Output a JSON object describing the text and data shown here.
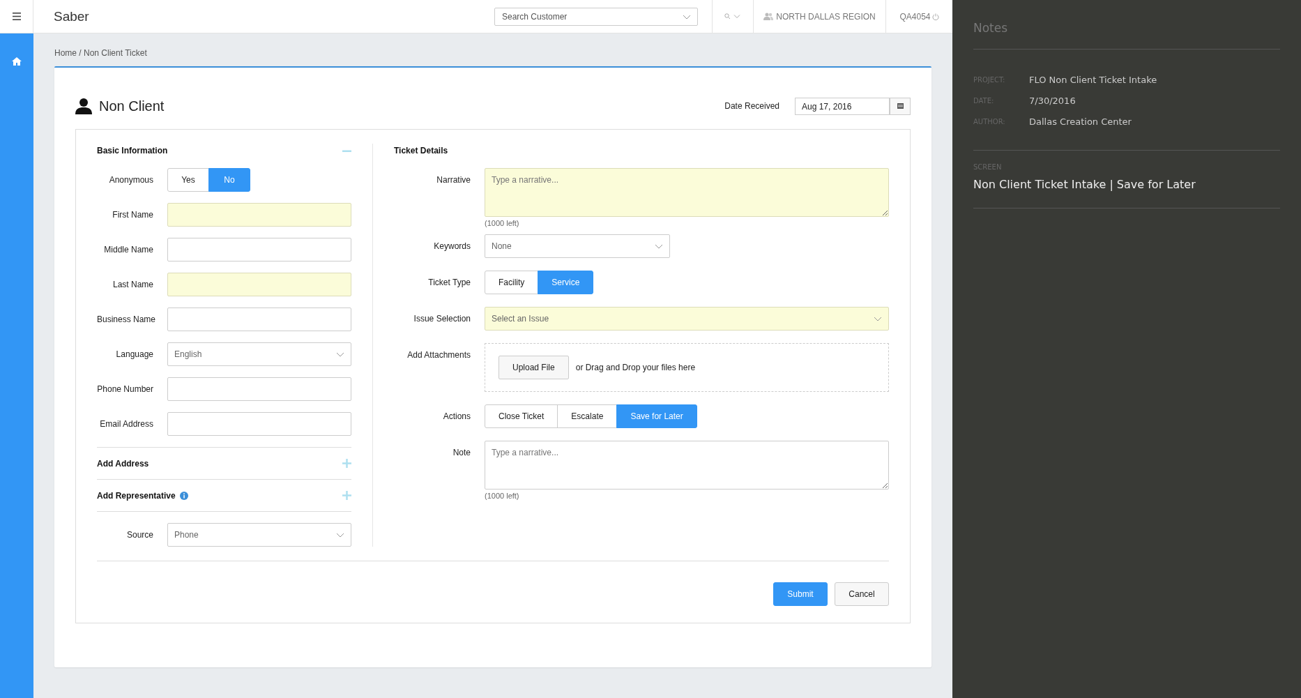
{
  "header": {
    "brand": "Saber",
    "search": {
      "placeholder": "Search Customer"
    },
    "region": "NORTH DALLAS REGION",
    "user": "QA4054"
  },
  "breadcrumb": "Home / Non Client Ticket",
  "page_title": "Non Client",
  "date_received": {
    "label": "Date Received",
    "value": "Aug 17, 2016"
  },
  "basic_information": {
    "title": "Basic Information",
    "expanded": true,
    "fields": [
      {
        "kind": "toggle",
        "label": "Anonymous",
        "options": [
          {
            "label": "Yes",
            "selected": false
          },
          {
            "label": "No",
            "selected": true
          }
        ]
      },
      {
        "kind": "text",
        "label": "First Name",
        "required": true
      },
      {
        "kind": "text",
        "label": "Middle Name",
        "required": false
      },
      {
        "kind": "text",
        "label": "Last Name",
        "required": true
      },
      {
        "kind": "text",
        "label": "Business Name",
        "required": false
      },
      {
        "kind": "select",
        "label": "Language",
        "value": "English"
      },
      {
        "kind": "text",
        "label": "Phone Number",
        "required": false
      },
      {
        "kind": "text",
        "label": "Email Address",
        "required": false
      }
    ],
    "sections": [
      {
        "title": "Add Address",
        "info": false,
        "expanded": false
      },
      {
        "title": "Add Representative",
        "info": true,
        "expanded": false
      }
    ],
    "source": {
      "label": "Source",
      "value": "Phone"
    }
  },
  "ticket_details": {
    "title": "Ticket Details",
    "fields": [
      {
        "kind": "textarea",
        "label": "Narrative",
        "placeholder": "Type a narrative...",
        "counter": "(1000 left)",
        "required": true
      },
      {
        "kind": "select",
        "label": "Keywords",
        "value": "None",
        "required": false
      },
      {
        "kind": "toggle",
        "label": "Ticket Type",
        "options": [
          {
            "label": "Facility",
            "selected": false
          },
          {
            "label": "Service",
            "selected": true
          }
        ]
      },
      {
        "kind": "select",
        "label": "Issue Selection",
        "placeholder": "Select an Issue",
        "required": true
      },
      {
        "kind": "upload",
        "label": "Add Attachments",
        "button": "Upload File",
        "hint": "or Drag and Drop your files here"
      },
      {
        "kind": "toggle",
        "label": "Actions",
        "options": [
          {
            "label": "Close Ticket",
            "selected": false
          },
          {
            "label": "Escalate",
            "selected": false
          },
          {
            "label": "Save for Later",
            "selected": true
          }
        ]
      },
      {
        "kind": "textarea",
        "label": "Note",
        "placeholder": "Type a narrative...",
        "counter": "(1000 left)",
        "required": false
      }
    ]
  },
  "footer_buttons": [
    {
      "label": "Submit",
      "kind": "primary"
    },
    {
      "label": "Cancel",
      "kind": "default"
    }
  ],
  "notes": {
    "title": "Notes",
    "meta": [
      {
        "label": "PROJECT:",
        "value": "FLO Non Client Ticket Intake"
      },
      {
        "label": "DATE:",
        "value": "7/30/2016"
      },
      {
        "label": "AUTHOR:",
        "value": "Dallas Creation Center"
      }
    ],
    "screen_label": "SCREEN",
    "screen_value": "Non Client Ticket Intake | Save for Later"
  }
}
